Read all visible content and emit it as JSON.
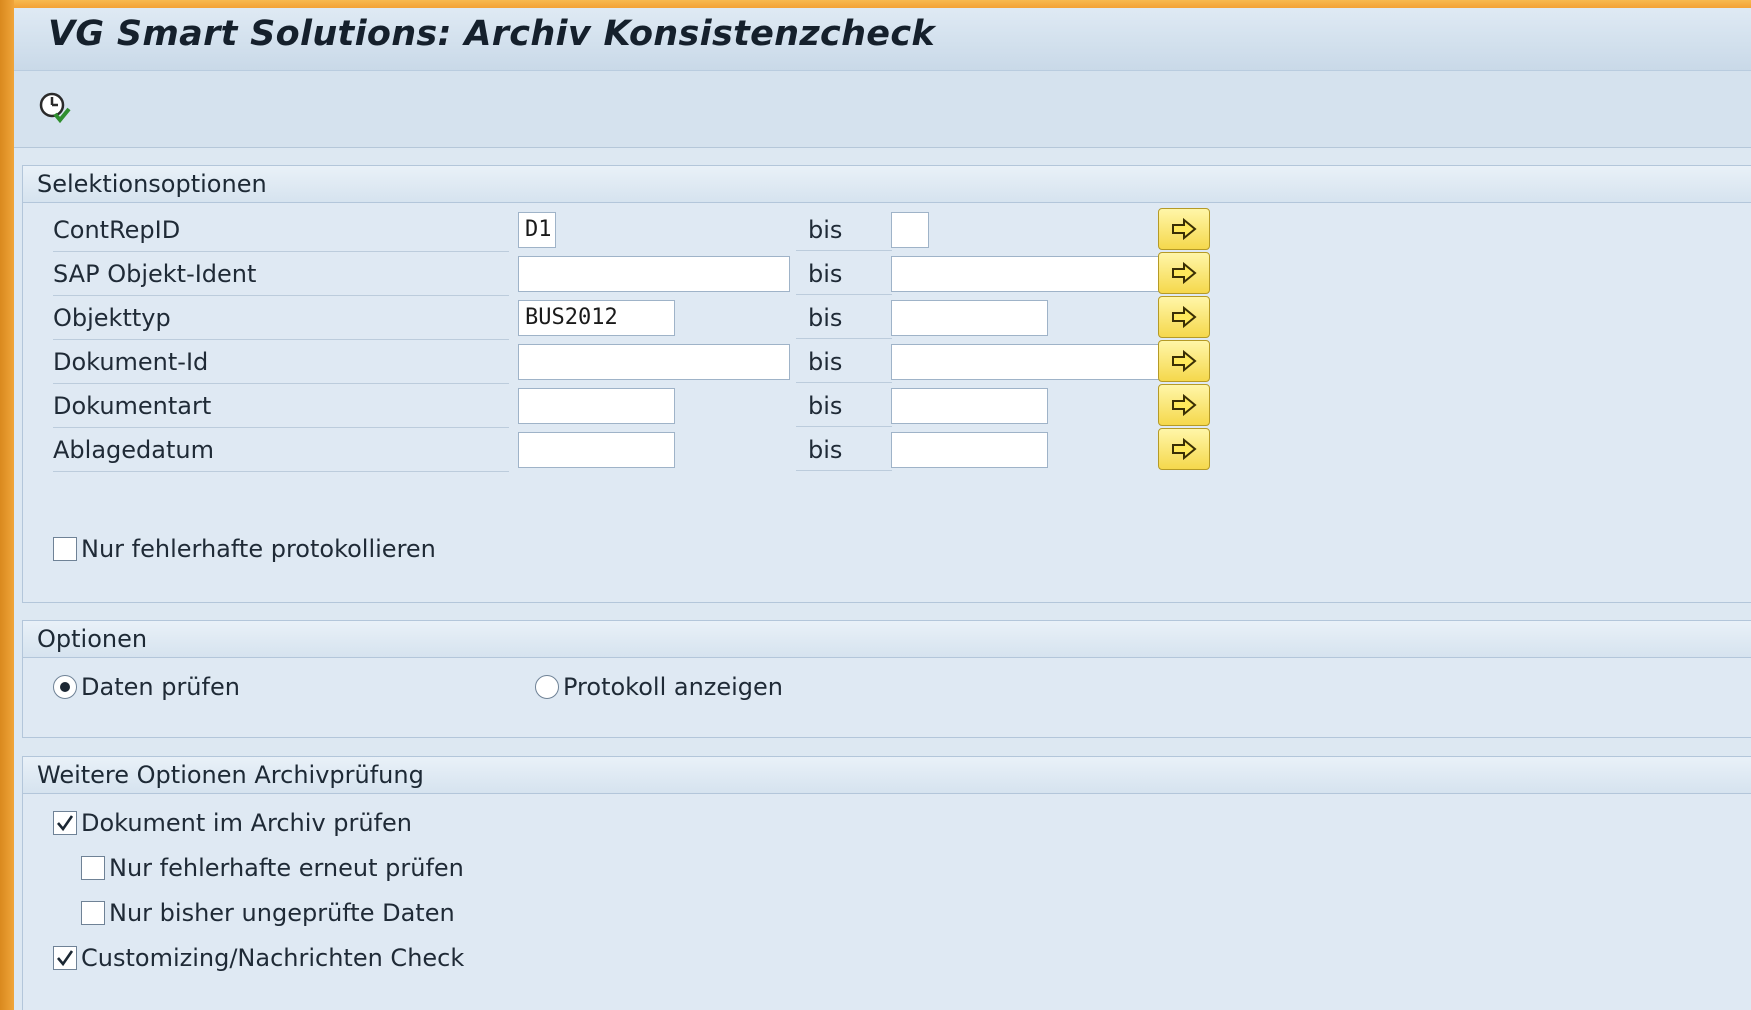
{
  "window": {
    "title": "VG Smart Solutions: Archiv Konsistenzcheck"
  },
  "toolbar": {
    "execute_icon": "clock-execute-icon"
  },
  "selection": {
    "header": "Selektionsoptionen",
    "to_label": "bis",
    "rows": [
      {
        "label": "ContRepID",
        "from": "D1",
        "to": ""
      },
      {
        "label": "SAP Objekt-Ident",
        "from": "",
        "to": ""
      },
      {
        "label": "Objekttyp",
        "from": "BUS2012",
        "to": ""
      },
      {
        "label": "Dokument-Id",
        "from": "",
        "to": ""
      },
      {
        "label": "Dokumentart",
        "from": "",
        "to": ""
      },
      {
        "label": "Ablagedatum",
        "from": "",
        "to": ""
      }
    ],
    "only_errors": {
      "label": "Nur fehlerhafte protokollieren",
      "checked": false
    }
  },
  "options": {
    "header": "Optionen",
    "radios": [
      {
        "label": "Daten prüfen",
        "selected": true
      },
      {
        "label": "Protokoll anzeigen",
        "selected": false
      }
    ]
  },
  "further": {
    "header": "Weitere Optionen Archivprüfung",
    "checks": [
      {
        "label": "Dokument im Archiv prüfen",
        "checked": true
      },
      {
        "label": "Nur fehlerhafte erneut prüfen",
        "checked": false
      },
      {
        "label": "Nur bisher ungeprüfte Daten",
        "checked": false
      },
      {
        "label": "Customizing/Nachrichten Check",
        "checked": true
      }
    ]
  },
  "colors": {
    "accent": "#f5d84c",
    "frame": "#e8a13c",
    "panel": "#dfe9f3"
  }
}
